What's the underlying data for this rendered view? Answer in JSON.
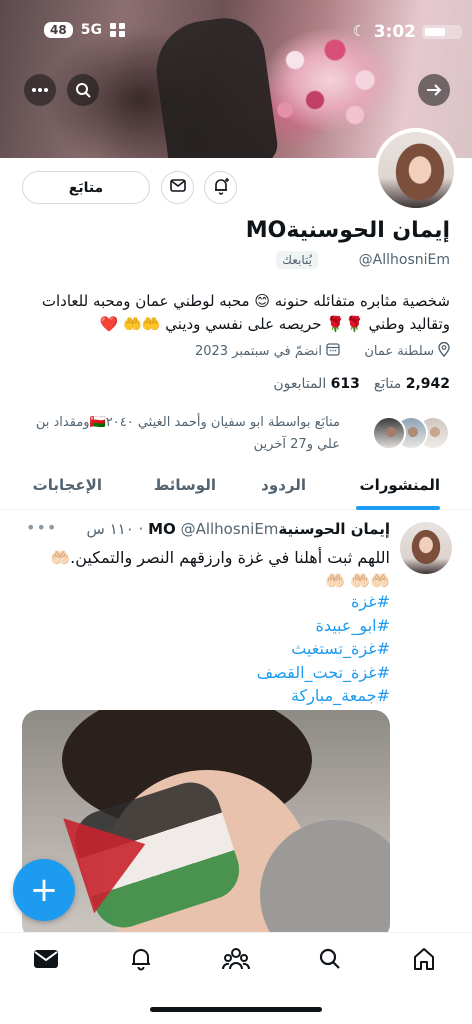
{
  "status_bar": {
    "time": "3:02",
    "battery": "48",
    "network": "5G"
  },
  "profile": {
    "name": "إيمان الحوسنيةMO",
    "handle": "@AllhosniEm",
    "follows_you": "يُتابعك",
    "follow_button": "متابَع",
    "bio": "شخصية مثابره متفائله حنونه 😊 محبه لوطني عمان ومحبه للعادات وتقاليد وطني 🌹🌹 حريصه على نفسي وديني 🤲🤲 ❤️",
    "location": "سلطنة عمان",
    "joined": "انضمّ في سبتمبر 2023",
    "following_count": "2,942",
    "following_label": "متابَع",
    "followers_count": "613",
    "followers_label": "المتابعون",
    "followed_by": "متابَع بواسطة ابو سفيان وأحمد الغيثي 🇴🇲٢٠٤٠ومقداد بن علي و27 آخرين"
  },
  "tabs": [
    {
      "label": "المنشورات",
      "active": true
    },
    {
      "label": "الردود",
      "active": false
    },
    {
      "label": "الوسائط",
      "active": false
    },
    {
      "label": "الإعجابات",
      "active": false
    }
  ],
  "post": {
    "author_name": "إيمان الحوسنيةMO",
    "author_handle": "@AllhosniEm",
    "time": "١١٠ س",
    "text": "اللهم ثبت أهلنا في غزة وارزقهم النصر والتمكين.🤲🏻🤲🏻🤲🏻 🤲🏻",
    "hashtags": [
      "#غزة",
      "#ابو_عبيدة",
      "#غزة_تستغيث",
      "#غزة_تحت_القصف",
      "#جمعة_مباركة"
    ]
  },
  "icons": {
    "back": "arrow-right-icon",
    "search": "search-icon",
    "more": "more-icon",
    "message": "mail-icon",
    "notify": "bell-plus-icon",
    "location": "location-pin-icon",
    "calendar": "calendar-icon",
    "compose": "plus-icon"
  },
  "colors": {
    "accent": "#1d9bf0",
    "text": "#0f1419",
    "muted": "#536471"
  }
}
